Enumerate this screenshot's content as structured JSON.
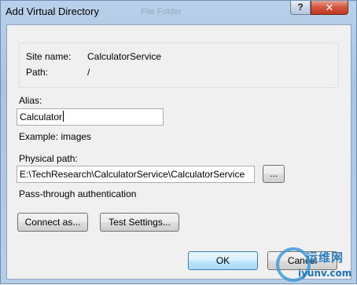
{
  "window": {
    "title": "Add Virtual Directory",
    "background_text": "File Folder",
    "help_label": "?",
    "close_label": "✕"
  },
  "site_info": {
    "site_name_label": "Site name:",
    "site_name_value": "CalculatorService",
    "path_label": "Path:",
    "path_value": "/"
  },
  "alias": {
    "label": "Alias:",
    "value": "Calculator",
    "example": "Example: images"
  },
  "physical_path": {
    "label": "Physical path:",
    "value": "E:\\TechResearch\\CalculatorService\\CalculatorService",
    "browse_label": "..."
  },
  "auth": {
    "label": "Pass-through authentication",
    "connect_as_label": "Connect as...",
    "test_settings_label": "Test Settings..."
  },
  "footer": {
    "ok_label": "OK",
    "cancel_label": "Cancel"
  },
  "watermark": {
    "cn_text": "运维网",
    "url_text": "iyunv.com"
  },
  "colors": {
    "frame": "#b9d1ea",
    "client": "#f0f0f0",
    "default_button_border": "#3c7fb1",
    "close_button": "#c1351f"
  }
}
